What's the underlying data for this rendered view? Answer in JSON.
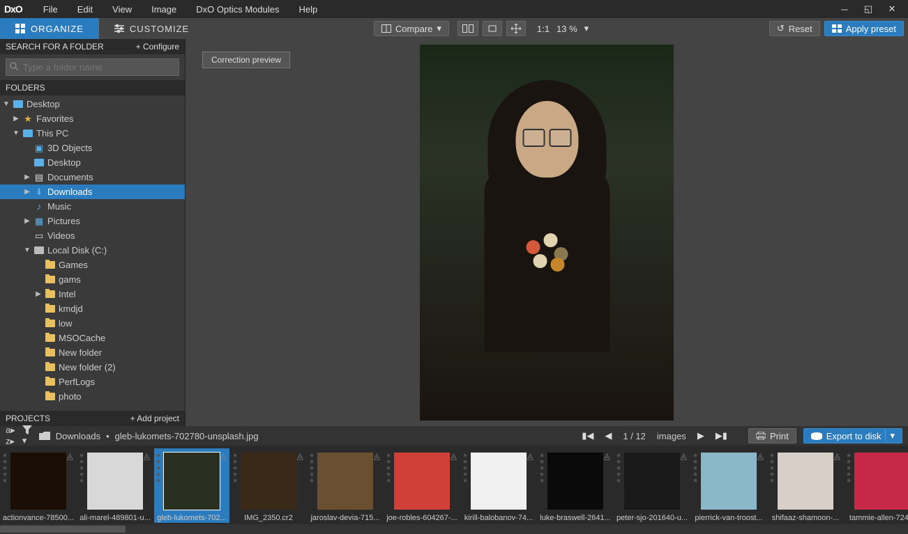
{
  "menu": [
    "File",
    "Edit",
    "View",
    "Image",
    "DxO Optics Modules",
    "Help"
  ],
  "logo": "DxO",
  "tabs": {
    "organize": "ORGANIZE",
    "customize": "CUSTOMIZE"
  },
  "toolbar": {
    "compare": "Compare",
    "onetoone": "1:1",
    "zoom": "13 %",
    "reset": "Reset",
    "apply": "Apply preset"
  },
  "sidebar": {
    "search_hdr": "SEARCH FOR A FOLDER",
    "configure": "+ Configure",
    "search_ph": "Type a folder name",
    "folders_hdr": "FOLDERS",
    "projects_hdr": "PROJECTS",
    "add_project": "+ Add project"
  },
  "tree": [
    {
      "d": 0,
      "a": "▼",
      "i": "pc",
      "t": "Desktop"
    },
    {
      "d": 1,
      "a": "▶",
      "i": "star",
      "t": "Favorites"
    },
    {
      "d": 1,
      "a": "▼",
      "i": "pc",
      "t": "This PC"
    },
    {
      "d": 2,
      "a": "",
      "i": "cube",
      "t": "3D Objects"
    },
    {
      "d": 2,
      "a": "",
      "i": "pc",
      "t": "Desktop"
    },
    {
      "d": 2,
      "a": "▶",
      "i": "doc",
      "t": "Documents"
    },
    {
      "d": 2,
      "a": "▶",
      "i": "dl",
      "t": "Downloads",
      "sel": true
    },
    {
      "d": 2,
      "a": "",
      "i": "music",
      "t": "Music"
    },
    {
      "d": 2,
      "a": "▶",
      "i": "pic",
      "t": "Pictures"
    },
    {
      "d": 2,
      "a": "",
      "i": "vid",
      "t": "Videos"
    },
    {
      "d": 2,
      "a": "▼",
      "i": "hd",
      "t": "Local Disk (C:)"
    },
    {
      "d": 3,
      "a": "",
      "i": "f",
      "t": "Games"
    },
    {
      "d": 3,
      "a": "",
      "i": "f",
      "t": "gams"
    },
    {
      "d": 3,
      "a": "▶",
      "i": "f",
      "t": "Intel"
    },
    {
      "d": 3,
      "a": "",
      "i": "f",
      "t": "kmdjd"
    },
    {
      "d": 3,
      "a": "",
      "i": "f",
      "t": "low"
    },
    {
      "d": 3,
      "a": "",
      "i": "f",
      "t": "MSOCache"
    },
    {
      "d": 3,
      "a": "",
      "i": "f",
      "t": "New folder"
    },
    {
      "d": 3,
      "a": "",
      "i": "f",
      "t": "New folder (2)"
    },
    {
      "d": 3,
      "a": "",
      "i": "f",
      "t": "PerfLogs"
    },
    {
      "d": 3,
      "a": "",
      "i": "f",
      "t": "photo"
    }
  ],
  "preview_label": "Correction preview",
  "path": {
    "folder": "Downloads",
    "sep": "•",
    "file": "gleb-lukomets-702780-unsplash.jpg"
  },
  "pager": {
    "pos": "1 / 12",
    "label": "images"
  },
  "print": "Print",
  "export": "Export to disk",
  "thumbs": [
    {
      "name": "actionvance-78500...",
      "bg": "#1a0e05"
    },
    {
      "name": "ali-marel-489801-u...",
      "bg": "#d8d8d8"
    },
    {
      "name": "gleb-lukomets-702...",
      "bg": "#2a3020",
      "sel": true
    },
    {
      "name": "IMG_2350.cr2",
      "bg": "#3a2818"
    },
    {
      "name": "jaroslav-devia-715...",
      "bg": "#6a5030"
    },
    {
      "name": "joe-robles-604267-...",
      "bg": "#d04038"
    },
    {
      "name": "kirill-balobanov-74...",
      "bg": "#f0f0f0"
    },
    {
      "name": "luke-braswell-2641...",
      "bg": "#0a0a0a"
    },
    {
      "name": "peter-sjo-201640-u...",
      "bg": "#1a1a1a"
    },
    {
      "name": "pierrick-van-troost...",
      "bg": "#8ab8c8"
    },
    {
      "name": "shifaaz-shamoon-...",
      "bg": "#d8d0c8"
    },
    {
      "name": "tammie-allen-724...",
      "bg": "#c82848"
    }
  ]
}
